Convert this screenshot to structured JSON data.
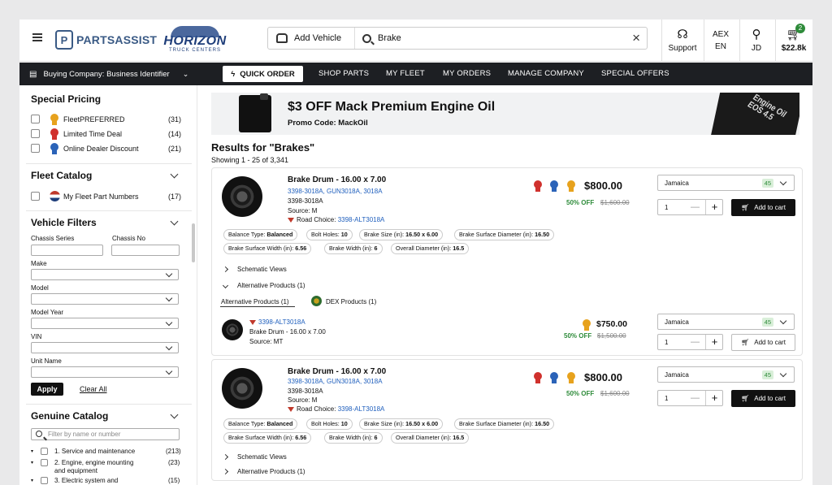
{
  "header": {
    "logo_pa_text": "PARTSASSIST",
    "logo_horizon_text": "HORIZON",
    "logo_horizon_sub": "TRUCK CENTERS",
    "add_vehicle": "Add Vehicle",
    "search_value": "Brake",
    "support": "Support",
    "airport": "AEX",
    "lang": "EN",
    "user": "JD",
    "cart_total": "$22.8k",
    "cart_count": "2"
  },
  "nav": {
    "buying_company": "Buying Company: Business Identifier",
    "quick_order": "QUICK ORDER",
    "items": [
      "SHOP PARTS",
      "MY FLEET",
      "MY ORDERS",
      "MANAGE COMPANY",
      "SPECIAL OFFERS"
    ]
  },
  "sidebar": {
    "special_pricing": {
      "title": "Special Pricing",
      "items": [
        {
          "label": "FleetPREFERRED",
          "count": "(31)"
        },
        {
          "label": "Limited Time Deal",
          "count": "(14)"
        },
        {
          "label": "Online Dealer Discount",
          "count": "(21)"
        }
      ]
    },
    "fleet_catalog": {
      "title": "Fleet Catalog",
      "items": [
        {
          "label": "My Fleet Part Numbers",
          "count": "(17)"
        }
      ]
    },
    "vehicle_filters": {
      "title": "Vehicle Filters",
      "chassis_series": "Chassis Series",
      "chassis_no": "Chassis No",
      "make": "Make",
      "model": "Model",
      "model_year": "Model Year",
      "vin": "VIN",
      "unit_name": "Unit Name",
      "apply": "Apply",
      "clear_all": "Clear All"
    },
    "genuine_catalog": {
      "title": "Genuine Catalog",
      "placeholder": "Filter by name or number",
      "items": [
        {
          "label": "1. Service and maintenance",
          "count": "(213)"
        },
        {
          "label": "2. Engine, engine mounting and equipment",
          "count": "(23)"
        },
        {
          "label": "3. Electric system and",
          "count": "(15)"
        }
      ]
    }
  },
  "promo": {
    "title": "$3 OFF Mack Premium Engine Oil",
    "code": "Promo Code: MackOil",
    "box_text": "Engine Oil EOS 4.5"
  },
  "results": {
    "title": "Results for \"Brakes\"",
    "showing": "Showing 1 - 25 of 3,341"
  },
  "products": [
    {
      "name": "Brake Drum - 16.00 x 7.00",
      "links": "3398-3018A,  GUN3018A,  3018A",
      "part": "3398-3018A",
      "source": "Source: M",
      "road_choice_label": "Road Choice: ",
      "road_choice_link": "3398-ALT3018A",
      "price": "$800.00",
      "off": "50% OFF",
      "old": "$1,600.00",
      "location": "Jamaica",
      "stock": "45",
      "qty": "1",
      "add": "Add to cart",
      "specs": [
        {
          "k": "Balance Type: ",
          "v": "Balanced"
        },
        {
          "k": "Bolt Holes: ",
          "v": "10"
        },
        {
          "k": "Brake Size (in): ",
          "v": "16.50 x 6.00"
        },
        {
          "k": "Brake Surface Diameter (in): ",
          "v": "16.50"
        },
        {
          "k": "Brake Surface Width (in): ",
          "v": "6.56"
        },
        {
          "k": "Brake Width (in): ",
          "v": "6"
        },
        {
          "k": "Overall Diameter (in): ",
          "v": "16.5"
        }
      ],
      "schematic": "Schematic Views",
      "alternatives": "Alternative Products (1)",
      "tab_alt": "Alternative Products (1)",
      "tab_dex": "DEX Products (1)",
      "alt": {
        "link": "3398-ALT3018A",
        "name": "Brake Drum - 16.00 x 7.00",
        "source": "Source: MT",
        "price": "$750.00",
        "off": "50% OFF",
        "old": "$1,500.00",
        "location": "Jamaica",
        "stock": "45",
        "qty": "1",
        "add": "Add to cart"
      }
    },
    {
      "name": "Brake Drum - 16.00 x 7.00",
      "links": "3398-3018A,  GUN3018A,  3018A",
      "part": "3398-3018A",
      "source": "Source: M",
      "road_choice_label": "Road Choice: ",
      "road_choice_link": "3398-ALT3018A",
      "price": "$800.00",
      "off": "50% OFF",
      "old": "$1,600.00",
      "location": "Jamaica",
      "stock": "45",
      "qty": "1",
      "add": "Add to cart",
      "specs": [
        {
          "k": "Balance Type: ",
          "v": "Balanced"
        },
        {
          "k": "Bolt Holes: ",
          "v": "10"
        },
        {
          "k": "Brake Size (in): ",
          "v": "16.50 x 6.00"
        },
        {
          "k": "Brake Surface Diameter (in): ",
          "v": "16.50"
        },
        {
          "k": "Brake Surface Width (in): ",
          "v": "6.56"
        },
        {
          "k": "Brake Width (in): ",
          "v": "6"
        },
        {
          "k": "Overall Diameter (in): ",
          "v": "16.5"
        }
      ],
      "schematic": "Schematic Views",
      "alternatives": "Alternative Products (1)"
    }
  ],
  "colors": {
    "accent_dark": "#1d1f23",
    "link": "#1f5fbd",
    "discount": "#2e8b3a",
    "brand_pa": "#3a5a85",
    "brand_horizon": "#1f3e7a"
  },
  "icons": [
    "menu-icon",
    "truck-icon",
    "search-icon",
    "close-icon",
    "headset-icon",
    "user-icon",
    "cart-icon",
    "building-icon",
    "lightning-icon",
    "chevron-down-icon",
    "medal-icon"
  ]
}
